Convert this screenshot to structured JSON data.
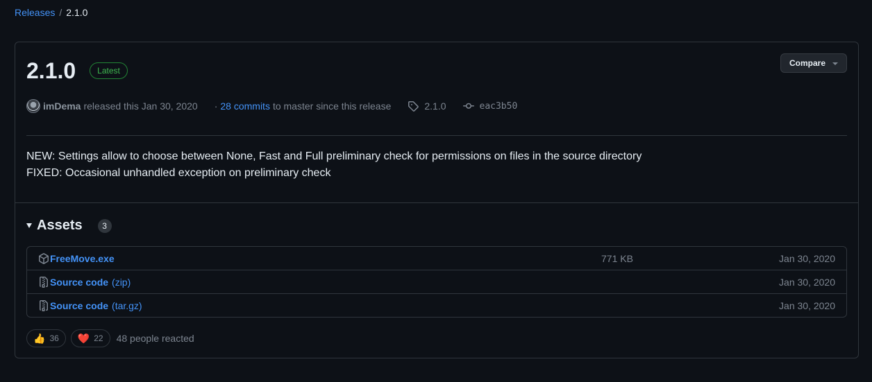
{
  "breadcrumb": {
    "parent": "Releases",
    "separator": "/",
    "current": "2.1.0"
  },
  "release": {
    "version": "2.1.0",
    "badge": "Latest",
    "compare_label": "Compare",
    "author": "imDema",
    "released_text": "released this Jan 30, 2020",
    "bullet": "·",
    "commits_link": "28 commits",
    "commits_suffix": "to master since this release",
    "tag": "2.1.0",
    "commit_sha": "eac3b50",
    "notes": [
      "NEW: Settings allow to choose between None, Fast and Full preliminary check for permissions on files in the source directory",
      "FIXED: Occasional unhandled exception on preliminary check"
    ]
  },
  "assets": {
    "title": "Assets",
    "count": "3",
    "items": [
      {
        "name": "FreeMove.exe",
        "ext": "",
        "size": "771 KB",
        "date": "Jan 30, 2020",
        "icon": "package-icon"
      },
      {
        "name": "Source code",
        "ext": "(zip)",
        "size": "",
        "date": "Jan 30, 2020",
        "icon": "file-zip-icon"
      },
      {
        "name": "Source code",
        "ext": "(tar.gz)",
        "size": "",
        "date": "Jan 30, 2020",
        "icon": "file-zip-icon"
      }
    ]
  },
  "reactions": {
    "thumbs_up": {
      "emoji": "👍",
      "count": "36"
    },
    "heart": {
      "emoji": "❤️",
      "count": "22"
    },
    "summary": "48 people reacted"
  },
  "colors": {
    "background": "#0d1117",
    "border": "#30363d",
    "link": "#4493f8",
    "latest_green": "#3fb950",
    "muted": "#7d8590"
  }
}
